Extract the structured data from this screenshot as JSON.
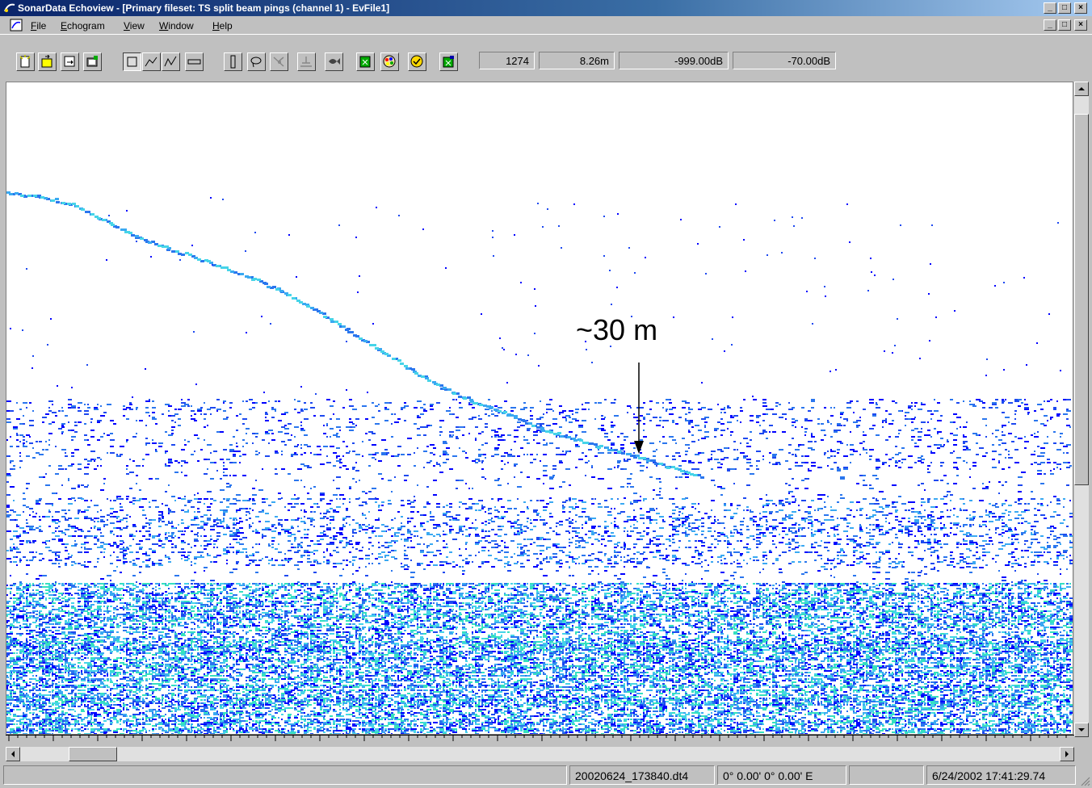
{
  "window": {
    "title": "SonarData Echoview - [Primary fileset: TS split beam pings (channel 1) - EvFile1]",
    "min_label": "_",
    "max_label": "□",
    "close_label": "×"
  },
  "menu": {
    "items": [
      {
        "underline": "F",
        "rest": "ile"
      },
      {
        "underline": "E",
        "rest": "chogram"
      },
      {
        "underline": "V",
        "rest": "iew"
      },
      {
        "underline": "W",
        "rest": "indow"
      },
      {
        "underline": "H",
        "rest": "elp"
      }
    ]
  },
  "toolbar": {
    "readouts": {
      "ping": "1274",
      "depth": "8.26m",
      "value": "-999.00dB",
      "threshold": "-70.00dB"
    }
  },
  "echogram": {
    "annotation": "~30 m",
    "palette": [
      "#0000ff",
      "#1d49f0",
      "#2a76ee",
      "#3aa9f2",
      "#46d4e8",
      "#35e0c0"
    ]
  },
  "status": {
    "left": "",
    "file": "20020624_173840.dt4",
    "position": "0° 0.00'  0° 0.00' E",
    "blank": "",
    "datetime": "6/24/2002 17:41:29.74"
  }
}
